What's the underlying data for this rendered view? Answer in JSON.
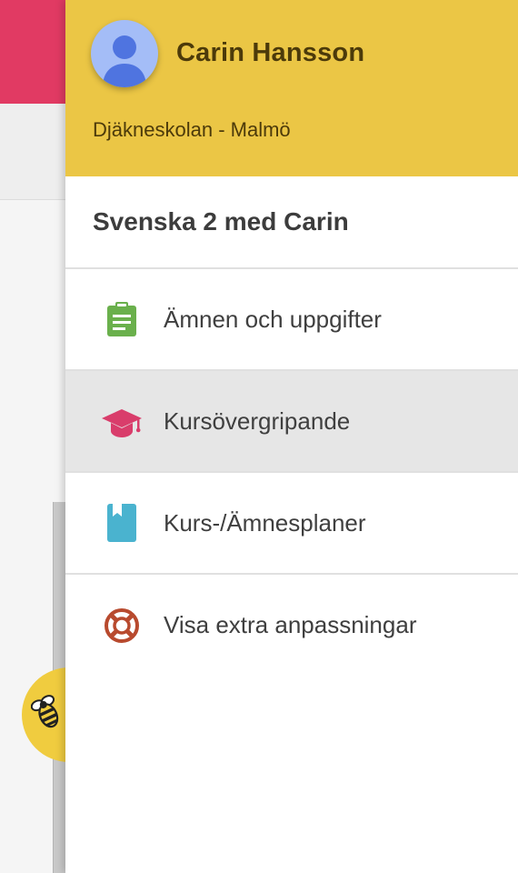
{
  "user": {
    "name": "Carin Hansson",
    "school": "Djäkneskolan - Malmö"
  },
  "course": {
    "title": "Svenska 2 med Carin"
  },
  "menu": [
    {
      "label": "Ämnen och uppgifter",
      "icon": "clipboard-icon",
      "color": "#6ab04c"
    },
    {
      "label": "Kursövergripande",
      "icon": "graduation-cap-icon",
      "color": "#d93d6b",
      "active": true
    },
    {
      "label": "Kurs-/Ämnesplaner",
      "icon": "book-icon",
      "color": "#4ab3cf"
    },
    {
      "label": "Visa extra anpassningar",
      "icon": "lifebuoy-icon",
      "color": "#b84a2e"
    }
  ],
  "colors": {
    "header_bg": "#ebc645",
    "app_accent": "#e13a63",
    "active_item_bg": "#e6e6e6"
  }
}
